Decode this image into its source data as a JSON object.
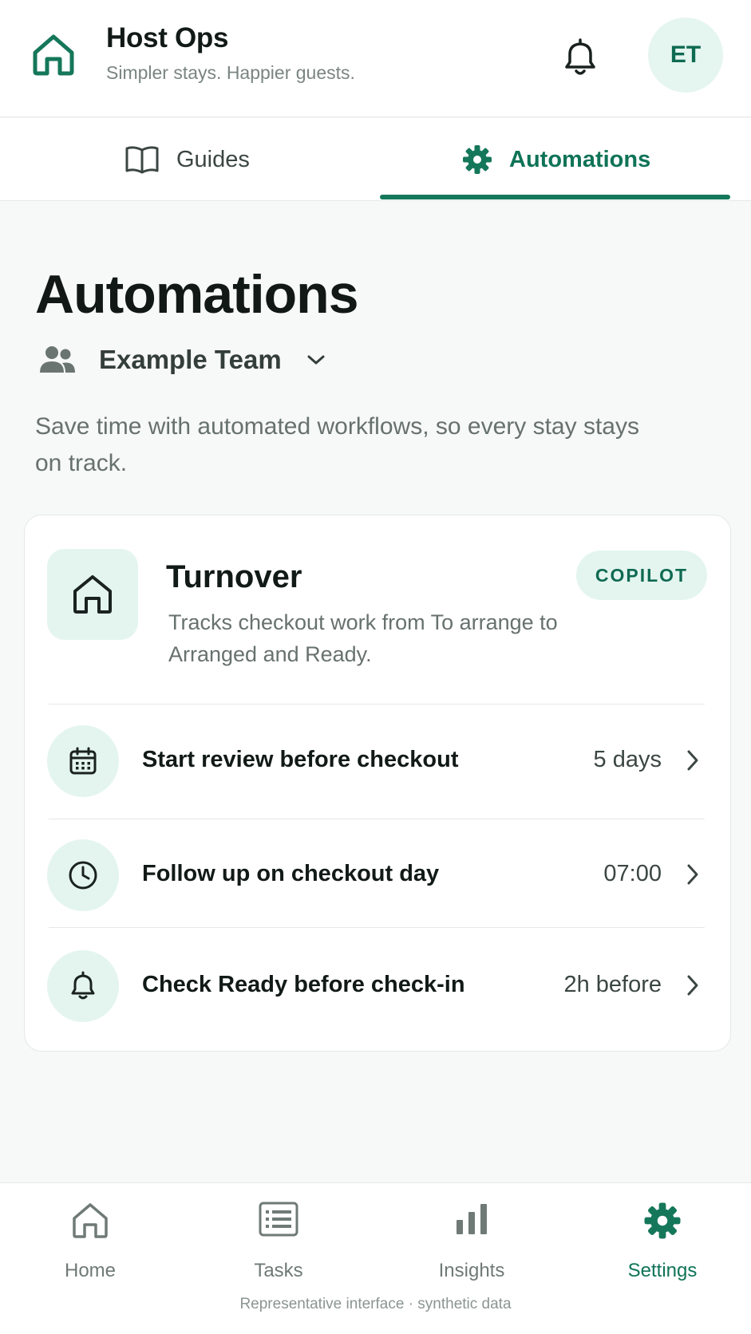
{
  "header": {
    "app_title": "Host Ops",
    "app_subtitle": "Simpler stays. Happier guests.",
    "avatar_initials": "ET",
    "logo_icon": "house-icon",
    "notification_icon": "bell-icon"
  },
  "tabs": [
    {
      "label": "Guides",
      "icon": "book-icon",
      "active": false
    },
    {
      "label": "Automations",
      "icon": "gear-icon",
      "active": true
    }
  ],
  "main": {
    "title": "Automations",
    "team": {
      "name": "Example Team",
      "icon": "people-icon"
    },
    "description": "Save time with automated workflows, so every stay stays on track."
  },
  "card": {
    "title": "Turnover",
    "description": "Tracks checkout work from To arrange to Arranged and Ready.",
    "badge": "COPILOT",
    "icon": "house-icon",
    "rows": [
      {
        "label": "Start review before checkout",
        "value": "5 days",
        "icon": "calendar-icon"
      },
      {
        "label": "Follow up on checkout day",
        "value": "07:00",
        "icon": "clock-icon"
      },
      {
        "label": "Check Ready before check-in",
        "value": "2h before",
        "icon": "bell-icon"
      }
    ]
  },
  "bottom_nav": [
    {
      "label": "Home",
      "icon": "house-icon",
      "active": false
    },
    {
      "label": "Tasks",
      "icon": "list-icon",
      "active": false
    },
    {
      "label": "Insights",
      "icon": "bar-chart-icon",
      "active": false
    },
    {
      "label": "Settings",
      "icon": "gear-icon",
      "active": true
    }
  ],
  "footnote": "Representative interface · synthetic data",
  "colors": {
    "accent": "#15775a",
    "accent_light": "#e4f5ef",
    "background": "#f7f8f8",
    "text_primary": "#121a18",
    "text_muted": "#67716e"
  }
}
